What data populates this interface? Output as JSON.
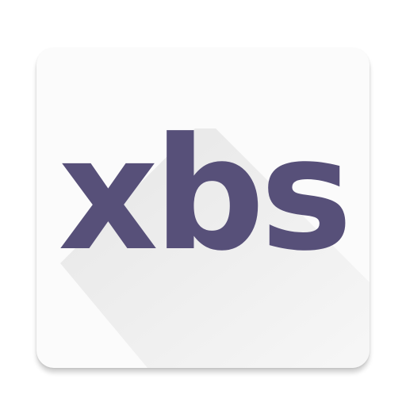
{
  "app_icon": {
    "logo_text": "xbs",
    "colors": {
      "logo": "#575079",
      "tile": "#fbfbfb",
      "shadow": "#e6e6e6"
    }
  }
}
